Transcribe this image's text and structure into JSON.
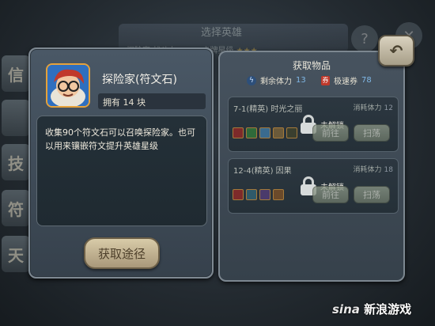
{
  "background": {
    "title": "选择英雄",
    "subline": "探险家   战斗力：978   卡牌星级",
    "stars": "★★★",
    "side_tabs": [
      "信",
      "",
      "技",
      "符",
      "天"
    ]
  },
  "item": {
    "name": "探险家(符文石)",
    "own_label": "拥有 14 块",
    "description": "收集90个符文石可以召唤探险家。也可以用来镶嵌符文提升英雄星级",
    "obtain_button": "获取途径"
  },
  "acquire": {
    "title": "获取物品",
    "stamina_label": "剩余体力",
    "stamina_value": "13",
    "ticket_label": "极速券",
    "ticket_value": "78",
    "stages": [
      {
        "name": "7-1(精英) 时光之丽",
        "cost_label": "消耗体力",
        "cost_value": "12",
        "lock_text": "未解锁",
        "go_button": "前往",
        "sweep_button": "扫荡",
        "drop_colors": [
          "#7d2a2a",
          "#2f6a3a",
          "#3a6b8f",
          "#6b5a3a",
          "#3a3f2f"
        ]
      },
      {
        "name": "12-4(精英) 因果",
        "cost_label": "消耗体力",
        "cost_value": "18",
        "lock_text": "未解锁",
        "go_button": "前往",
        "sweep_button": "扫荡",
        "drop_colors": [
          "#7d2a2a",
          "#2f5a6a",
          "#4a3a6b",
          "#6b4a2a"
        ]
      }
    ]
  },
  "back_button_icon": "back-arrow-icon",
  "watermark": {
    "logo": "sina",
    "text": "新浪游戏"
  }
}
